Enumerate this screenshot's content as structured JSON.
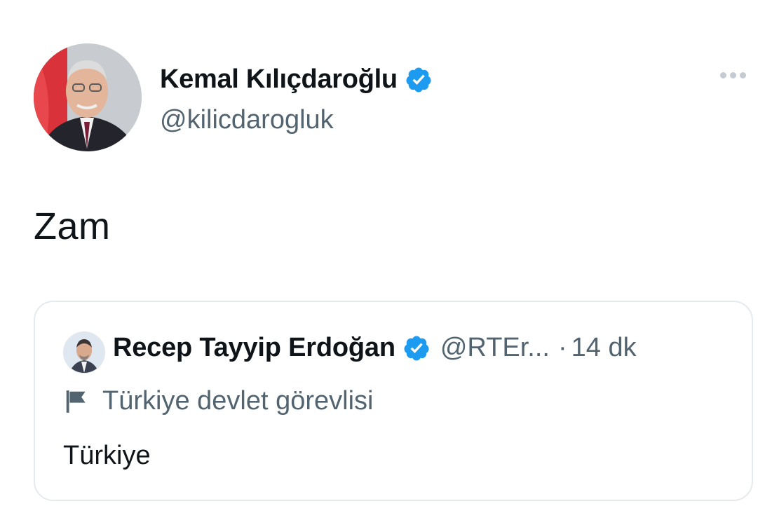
{
  "tweet": {
    "author": {
      "name": "Kemal Kılıçdaroğlu",
      "handle": "@kilicdarogluk",
      "verified": true,
      "avatar_icon": "profile-photo"
    },
    "more_icon": "more-horizontal-icon",
    "text": "Zam",
    "quoted": {
      "author": {
        "name": "Recep Tayyip Erdoğan",
        "handle": "@RTEr...",
        "verified": true,
        "avatar_icon": "profile-photo"
      },
      "separator": "·",
      "time": "14 dk",
      "label_icon": "flag-icon",
      "label": "Türkiye devlet görevlisi",
      "text": "Türkiye"
    }
  },
  "colors": {
    "text": "#0f1419",
    "secondary": "#536471",
    "verified": "#1d9bf0",
    "border": "#e6eaed"
  }
}
